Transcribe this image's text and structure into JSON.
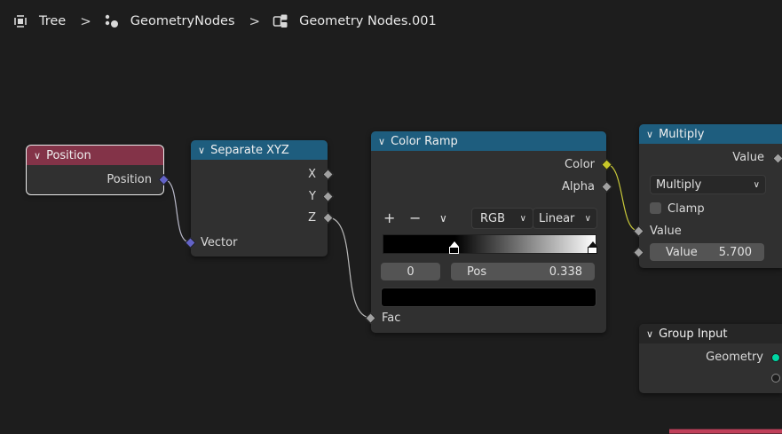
{
  "breadcrumb": {
    "items": [
      {
        "label": "Tree",
        "icon": "tree-view-icon"
      },
      {
        "label": "GeometryNodes",
        "icon": "geometry-nodes-icon"
      },
      {
        "label": "Geometry Nodes.001",
        "icon": "node-tree-icon"
      }
    ],
    "separator": ">"
  },
  "nodes": {
    "position": {
      "title": "Position",
      "outputs": [
        "Position"
      ]
    },
    "separate_xyz": {
      "title": "Separate XYZ",
      "outputs": [
        "X",
        "Y",
        "Z"
      ],
      "inputs": [
        "Vector"
      ]
    },
    "color_ramp": {
      "title": "Color Ramp",
      "outputs": [
        "Color",
        "Alpha"
      ],
      "color_mode": "RGB",
      "interpolation": "Linear",
      "stop_index": "0",
      "pos_label": "Pos",
      "pos_value": "0.338",
      "inputs": [
        "Fac"
      ]
    },
    "multiply": {
      "title": "Multiply",
      "output": "Value",
      "operation": "Multiply",
      "clamp_label": "Clamp",
      "clamp_checked": false,
      "input_label": "Value",
      "value_field_label": "Value",
      "value_field_value": "5.700"
    },
    "group_input": {
      "title": "Group Input",
      "outputs": [
        "Geometry"
      ]
    }
  },
  "colors": {
    "header_blue": "#1e5d7e",
    "header_red": "#833348",
    "vector_socket": "#6363c7",
    "color_socket": "#c7c729",
    "float_socket": "#a1a1a1",
    "geometry_socket": "#00d6a3"
  }
}
